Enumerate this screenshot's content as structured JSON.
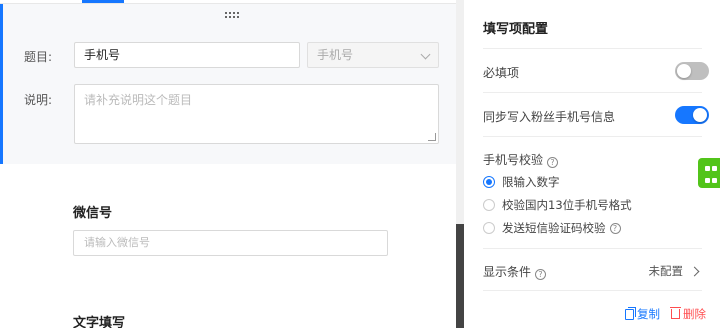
{
  "editor": {
    "title_label": "题目:",
    "title_value": "手机号",
    "type_select_value": "手机号",
    "description_label": "说明:",
    "description_placeholder": "请补充说明这个题目",
    "fields": [
      {
        "title": "微信号",
        "placeholder": "请输入微信号"
      },
      {
        "title": "文字填写"
      }
    ]
  },
  "panel": {
    "title": "填写项配置",
    "required_label": "必填项",
    "required_on": false,
    "sync_label": "同步写入粉丝手机号信息",
    "sync_on": true,
    "validation_label": "手机号校验",
    "validation_options": [
      {
        "label": "限输入数字",
        "checked": true
      },
      {
        "label": "校验国内13位手机号格式",
        "checked": false
      },
      {
        "label": "发送短信验证码校验",
        "checked": false
      }
    ],
    "condition_label": "显示条件",
    "condition_value": "未配置",
    "copy_label": "复制",
    "delete_label": "删除"
  },
  "colors": {
    "accent": "#1677ff",
    "danger": "#ff4d4f",
    "float_button": "#52c41a"
  }
}
